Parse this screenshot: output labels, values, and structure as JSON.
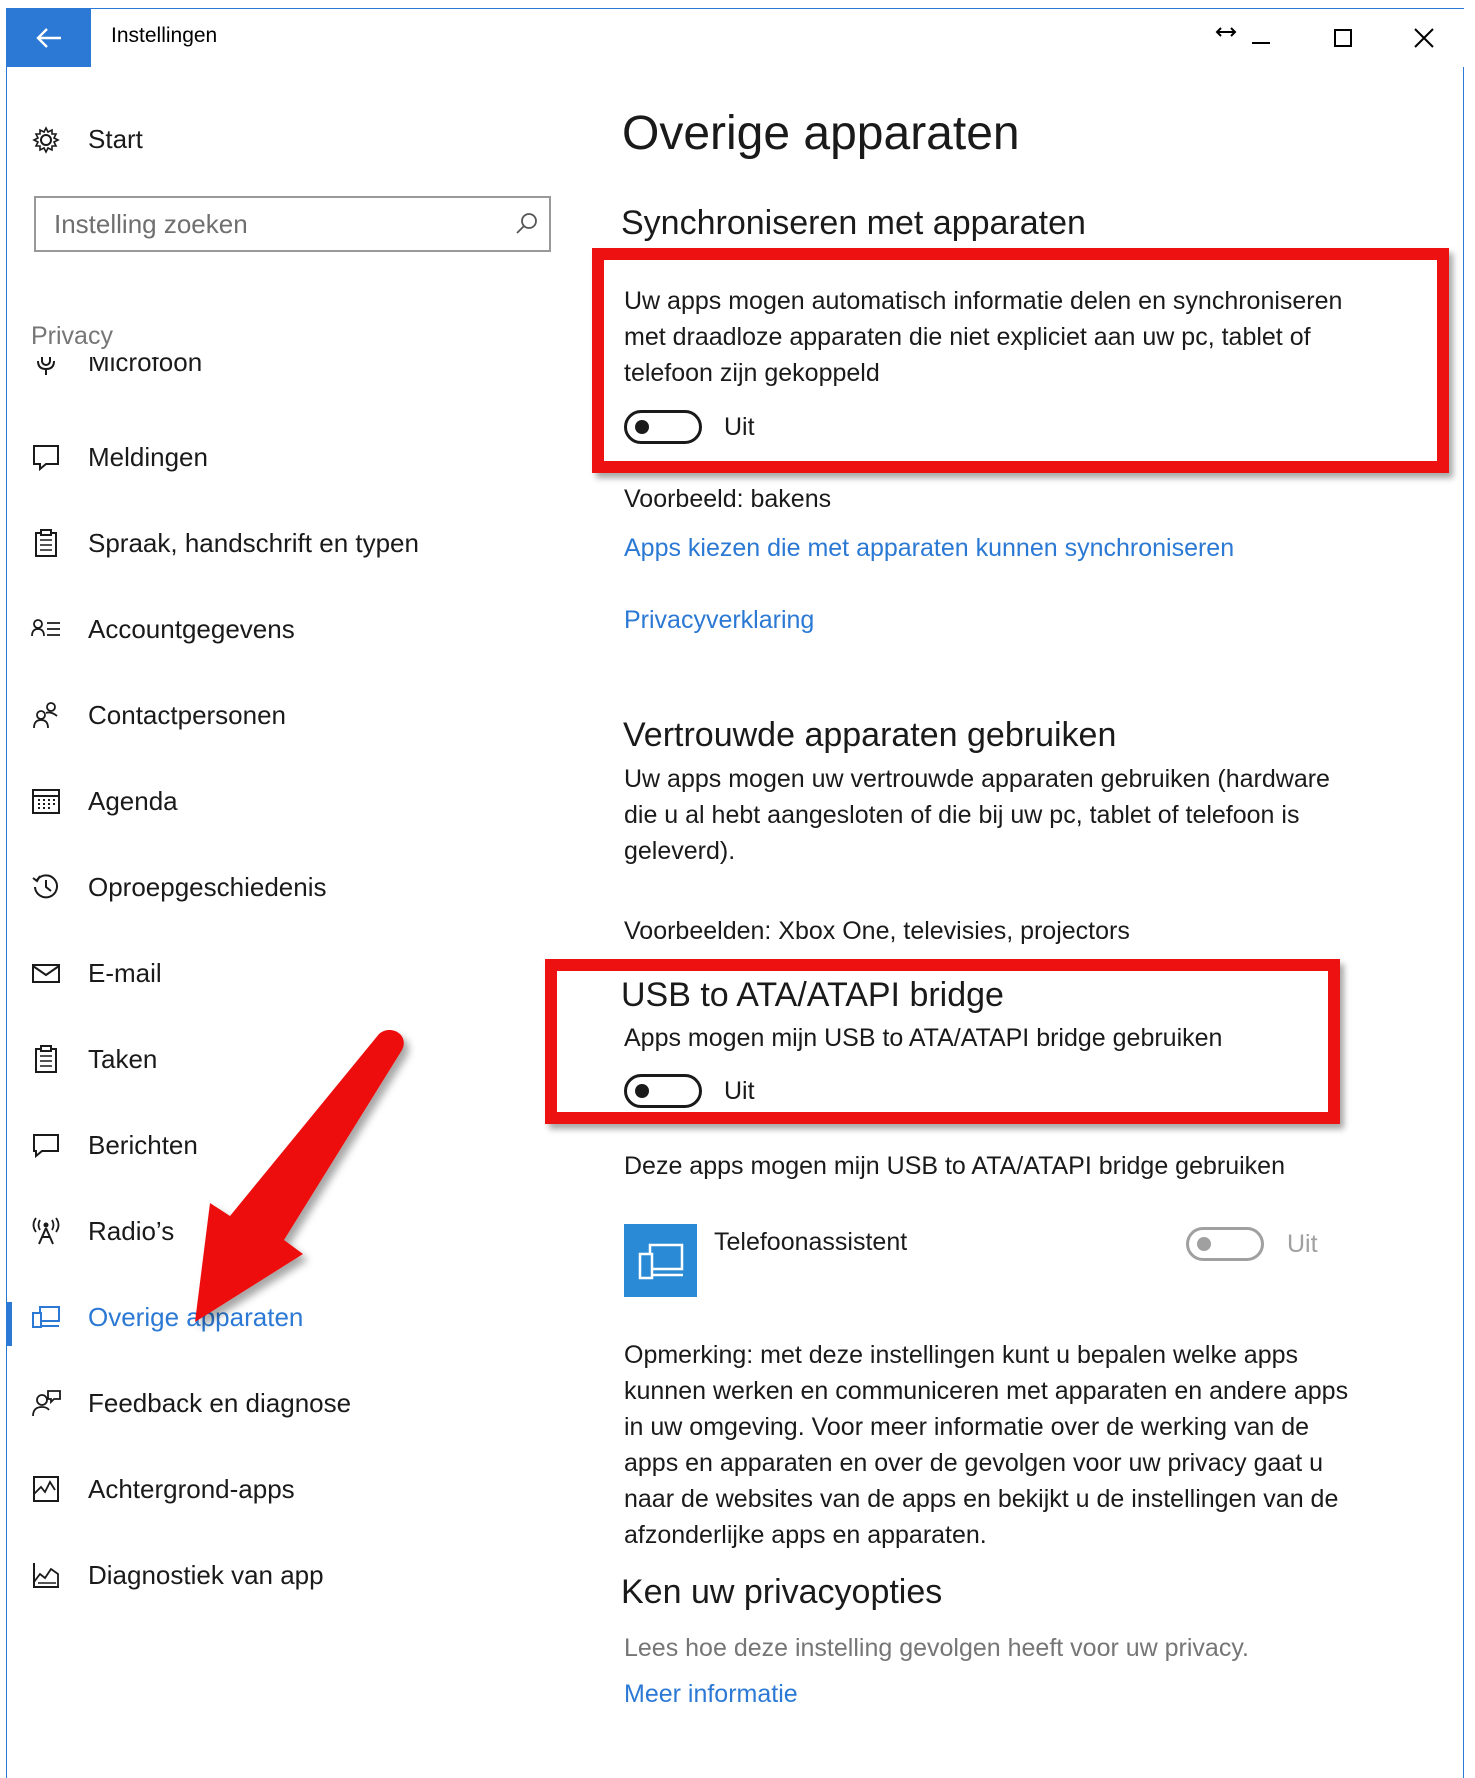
{
  "window": {
    "title": "Instellingen",
    "accent": "#2b79d4",
    "controls": [
      "resize-icon",
      "minimize-icon",
      "maximize-icon",
      "close-icon"
    ]
  },
  "sidebar": {
    "home_label": "Start",
    "search_placeholder": "Instelling zoeken",
    "section_label": "Privacy",
    "items": [
      {
        "label": "Microfoon",
        "icon": "microphone-icon"
      },
      {
        "label": "Meldingen",
        "icon": "notification-icon"
      },
      {
        "label": "Spraak, handschrift en typen",
        "icon": "clipboard-icon"
      },
      {
        "label": "Accountgegevens",
        "icon": "account-info-icon"
      },
      {
        "label": "Contactpersonen",
        "icon": "contacts-icon"
      },
      {
        "label": "Agenda",
        "icon": "calendar-icon"
      },
      {
        "label": "Oproepgeschiedenis",
        "icon": "history-icon"
      },
      {
        "label": "E-mail",
        "icon": "mail-icon"
      },
      {
        "label": "Taken",
        "icon": "tasks-icon"
      },
      {
        "label": "Berichten",
        "icon": "message-icon"
      },
      {
        "label": "Radio’s",
        "icon": "radio-icon"
      },
      {
        "label": "Overige apparaten",
        "icon": "devices-icon",
        "selected": true
      },
      {
        "label": "Feedback en diagnose",
        "icon": "feedback-icon"
      },
      {
        "label": "Achtergrond-apps",
        "icon": "background-apps-icon"
      },
      {
        "label": "Diagnostiek van app",
        "icon": "app-diagnostics-icon"
      }
    ]
  },
  "main": {
    "title": "Overige apparaten",
    "sync": {
      "heading": "Synchroniseren met apparaten",
      "description_lines": [
        "Uw apps mogen automatisch informatie delen en synchroniseren",
        "met draadloze apparaten die niet expliciet aan uw pc, tablet of",
        "telefoon zijn gekoppeld"
      ],
      "toggle_state": "Uit",
      "example": "Voorbeeld: bakens",
      "choose_apps_link": "Apps kiezen die met apparaten kunnen synchroniseren",
      "privacy_link": "Privacyverklaring"
    },
    "trusted": {
      "heading": "Vertrouwde apparaten gebruiken",
      "description_lines": [
        "Uw apps mogen uw vertrouwde apparaten gebruiken (hardware",
        "die u al hebt aangesloten of die bij uw pc, tablet of telefoon is",
        "geleverd)."
      ],
      "examples": "Voorbeelden: Xbox One, televisies, projectors"
    },
    "usb": {
      "heading": "USB to ATA/ATAPI bridge",
      "description": "Apps mogen mijn USB to ATA/ATAPI bridge gebruiken",
      "toggle_state": "Uit",
      "apps_label": "Deze apps mogen mijn USB to ATA/ATAPI bridge gebruiken",
      "app_name": "Telefoonassistent",
      "app_toggle_state": "Uit"
    },
    "note_lines": [
      "Opmerking: met deze instellingen kunt u bepalen welke apps",
      "kunnen werken en communiceren met apparaten en andere apps",
      "in uw omgeving. Voor meer informatie over de werking van de",
      "apps en apparaten en over de gevolgen voor uw privacy gaat u",
      "naar de websites van de apps en bekijkt u de instellingen van de",
      "afzonderlijke apps en apparaten."
    ],
    "privacy_options": {
      "heading": "Ken uw privacyopties",
      "description": "Lees hoe deze instelling gevolgen heeft voor uw privacy.",
      "more_link": "Meer informatie"
    }
  },
  "annotation": {
    "color": "#ee1111"
  }
}
